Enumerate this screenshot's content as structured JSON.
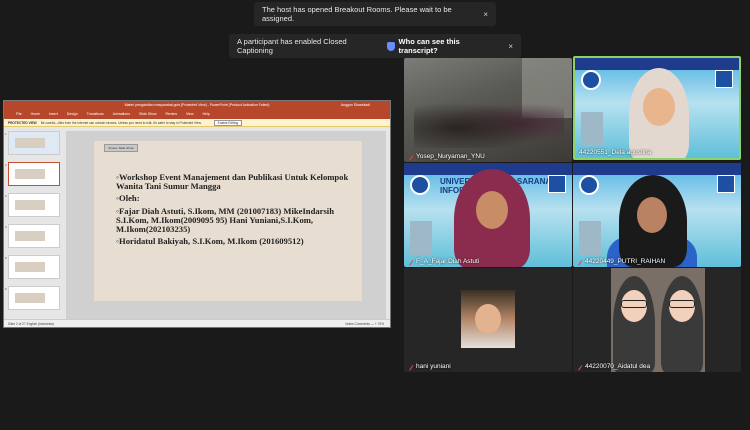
{
  "notifications": {
    "breakout": "The host has opened Breakout Rooms. Please wait to be assigned.",
    "captioning": "A participant has enabled Closed Captioning",
    "transcript_btn": "Who can see this transcript?",
    "close_glyph": "×"
  },
  "shared_screen": {
    "title": "Materi pengabdian masyarakat.pptx [Protected View] - PowerPoint (Product Activation Failed)",
    "user": "Anggun Ekasetiadi",
    "ribbon_tabs": [
      "File",
      "Home",
      "Insert",
      "Design",
      "Transitions",
      "Animations",
      "Slide Show",
      "Review",
      "View",
      "Help"
    ],
    "protected_view": {
      "label": "PROTECTED VIEW",
      "message": "Be careful—files from the Internet can contain viruses. Unless you need to edit, it's safer to stay in Protected View.",
      "button": "Enable Editing"
    },
    "thumb_numbers": [
      "1",
      "2",
      "3",
      "4",
      "5",
      "6"
    ],
    "slide_tag": "Screen Slide Show",
    "slide_lines": [
      "◦Workshop Event Manajement dan Publikasi Untuk Kelompok Wanita Tani Sumur Mangga",
      "◦Oleh:",
      "◦Fajar Diah Astuti, S.Ikom, MM (201007183) MikeIndarsih S.I.Kom, M.Ikom(2009095 95) Hani Yuniani,S.I.Kom, M.Ikom(202103235)",
      "◦Horidatul Bakiyah, S.I.Kom, M.Ikom (201609512)"
    ],
    "status_left": "Slide 2 of 27    English (Indonesia)",
    "status_right": "Notes    Comments    —  +  70%"
  },
  "participants": [
    {
      "name": "Yosep_Nuryaman_YNU"
    },
    {
      "name": "44220551_Dela agustina"
    },
    {
      "name": "F_A_Fajar Diah Astuti"
    },
    {
      "name": "44220449_PUTRI_RAIHAN"
    },
    {
      "name": "hani yuniani"
    },
    {
      "name": "44220070_Aidatul dea"
    }
  ],
  "banner": {
    "heading": "UNIVERSITAS BINA SARANA INFORMATIKA"
  },
  "colors": {
    "active_speaker": "#8bd36a",
    "muted_icon": "#e04545",
    "ppt_red": "#b7472a"
  }
}
